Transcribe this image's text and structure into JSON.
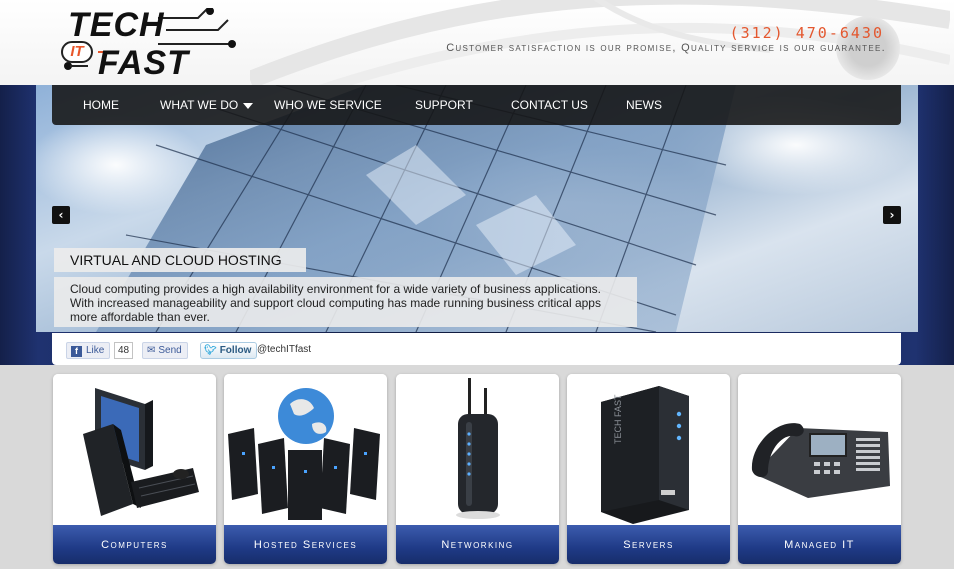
{
  "header": {
    "logo_top": "TECH",
    "logo_bottom": "FAST",
    "logo_badge": "IT",
    "phone": "(312) 470-6430",
    "tagline": "Customer satisfaction is our promise, Quality service is our guarantee."
  },
  "nav": {
    "items": [
      {
        "label": "HOME"
      },
      {
        "label": "WHAT WE DO",
        "has_dropdown": true
      },
      {
        "label": "WHO WE SERVICE"
      },
      {
        "label": "SUPPORT"
      },
      {
        "label": "CONTACT US"
      },
      {
        "label": "NEWS"
      }
    ]
  },
  "slider": {
    "prev_icon": "chevron-left-icon",
    "next_icon": "chevron-right-icon",
    "title": "VIRTUAL AND CLOUD HOSTING",
    "text": "Cloud computing provides a high availability environment for a wide variety of business applications. With increased manageability and support cloud computing has made running business critical apps more affordable than ever."
  },
  "social": {
    "like_label": "Like",
    "like_count": "48",
    "send_label": "Send",
    "follow_label": "Follow",
    "twitter_handle": "@techITfast"
  },
  "services": [
    {
      "label": "Computers",
      "icon": "computer-image"
    },
    {
      "label": "Hosted Services",
      "icon": "hosted-services-image"
    },
    {
      "label": "Networking",
      "icon": "router-image"
    },
    {
      "label": "Servers",
      "icon": "server-image"
    },
    {
      "label": "Managed IT",
      "icon": "phone-image"
    }
  ],
  "colors": {
    "accent_orange": "#e4572e",
    "nav_bg": "#161616",
    "card_label_blue": "#1f3a86",
    "band_navy": "#14204a"
  }
}
